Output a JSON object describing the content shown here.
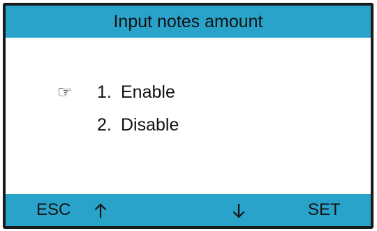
{
  "header": {
    "title": "Input notes amount"
  },
  "menu": {
    "pointer_icon": "pointing-hand-icon",
    "items": [
      {
        "number": "1.",
        "label": "Enable",
        "selected": true
      },
      {
        "number": "2.",
        "label": "Disable",
        "selected": false
      }
    ]
  },
  "footer": {
    "esc_label": "ESC",
    "up_icon": "arrow-up-icon",
    "down_icon": "arrow-down-icon",
    "set_label": "SET"
  },
  "colors": {
    "bar_background": "#2aa3cb",
    "frame": "#1a1a1a",
    "text": "#111111",
    "content_background": "#ffffff"
  }
}
